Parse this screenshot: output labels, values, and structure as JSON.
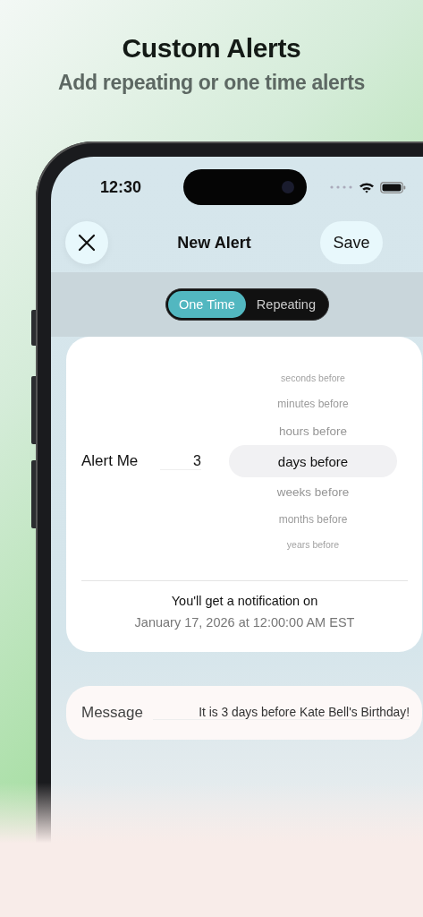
{
  "headline": {
    "title": "Custom Alerts",
    "subtitle": "Add repeating or one time alerts"
  },
  "status_bar": {
    "time": "12:30"
  },
  "nav": {
    "title": "New Alert",
    "action": "Save"
  },
  "segments": [
    {
      "label": "One Time",
      "selected": true
    },
    {
      "label": "Repeating",
      "selected": false
    }
  ],
  "alert": {
    "label": "Alert Me",
    "value": "3"
  },
  "picker": [
    {
      "label": "seconds before",
      "selected": false
    },
    {
      "label": "minutes before",
      "selected": false
    },
    {
      "label": "hours before",
      "selected": false
    },
    {
      "label": "days before",
      "selected": true
    },
    {
      "label": "weeks before",
      "selected": false
    },
    {
      "label": "months before",
      "selected": false
    },
    {
      "label": "years before",
      "selected": false
    }
  ],
  "notice": {
    "text": "You'll get a notification on",
    "date": "January 17, 2026 at 12:00:00 AM EST"
  },
  "message": {
    "label": "Message",
    "value": "It is 3 days before Kate Bell's Birthday!"
  }
}
